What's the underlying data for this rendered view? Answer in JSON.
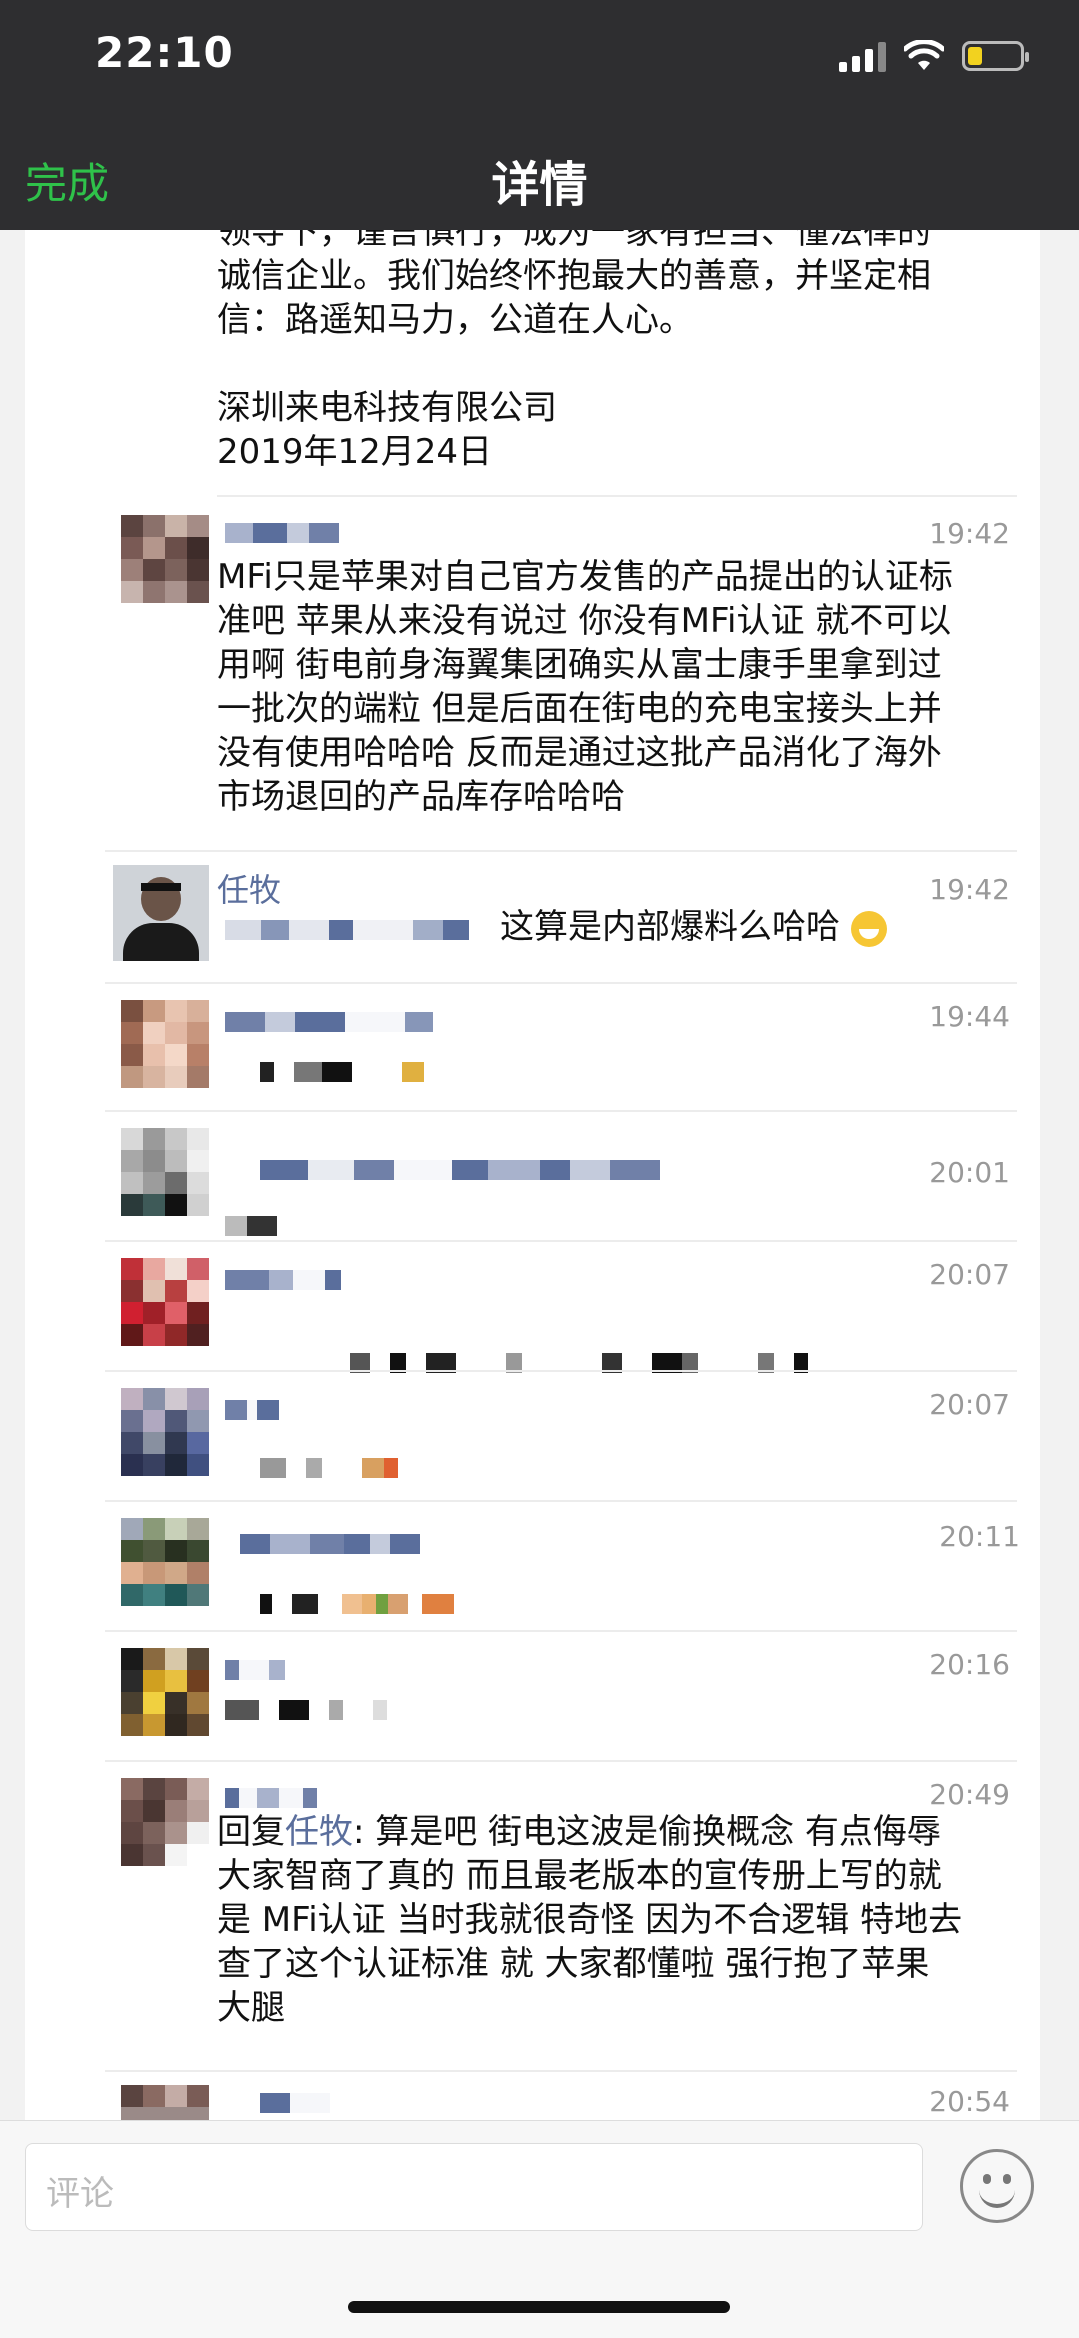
{
  "status": {
    "time": "22:10"
  },
  "nav": {
    "done_label": "完成",
    "title": "详情"
  },
  "article": {
    "lines": [
      "领导下，谨言慎行，成为一家有担当、懂法律的",
      "诚信企业。我们始终怀抱最大的善意，并坚定相",
      "信：路遥知马力，公道在人心。",
      "",
      "深圳来电科技有限公司",
      "2019年12月24日"
    ]
  },
  "comments": [
    {
      "name": "",
      "time": "19:42",
      "text": [
        "MFi只是苹果对自己官方发售的产品提出的认证标",
        "准吧 苹果从来没有说过 你没有MFi认证 就不可以",
        "用啊 街电前身海翼集团确实从富士康手里拿到过",
        "一批次的端粒 但是后面在街电的充电宝接头上并",
        "没有使用哈哈哈 反而是通过这批产品消化了海外",
        "市场退回的产品库存哈哈哈"
      ]
    },
    {
      "name": "任牧",
      "time": "19:42",
      "text": [
        "这算是内部爆料么哈哈"
      ]
    },
    {
      "name": "",
      "time": "19:44",
      "text": []
    },
    {
      "name": "",
      "time": "20:01",
      "text": []
    },
    {
      "name": "",
      "time": "20:07",
      "text": []
    },
    {
      "name": "",
      "time": "20:07",
      "text": []
    },
    {
      "name": "",
      "time": "20:11",
      "text": []
    },
    {
      "name": "",
      "time": "20:16",
      "text": []
    },
    {
      "name": "",
      "time": "20:49",
      "reply_prefix": "回复",
      "reply_to": "任牧",
      "reply_sep": ":",
      "text": [
        " 算是吧 街电这波是偷换概念 有点侮辱",
        "大家智商了真的 而且最老版本的宣传册上写的就",
        "是 MFi认证 当时我就很奇怪 因为不合逻辑 特地去",
        "查了这个认证标准 就 大家都懂啦 强行抱了苹果",
        "大腿"
      ]
    },
    {
      "name": "",
      "time": "20:54",
      "text": []
    }
  ],
  "input": {
    "placeholder": "评论"
  },
  "colors": {
    "nav_bg": "#2e2e30",
    "done_green": "#2fc24a",
    "name_blue": "#5a6e9c"
  }
}
